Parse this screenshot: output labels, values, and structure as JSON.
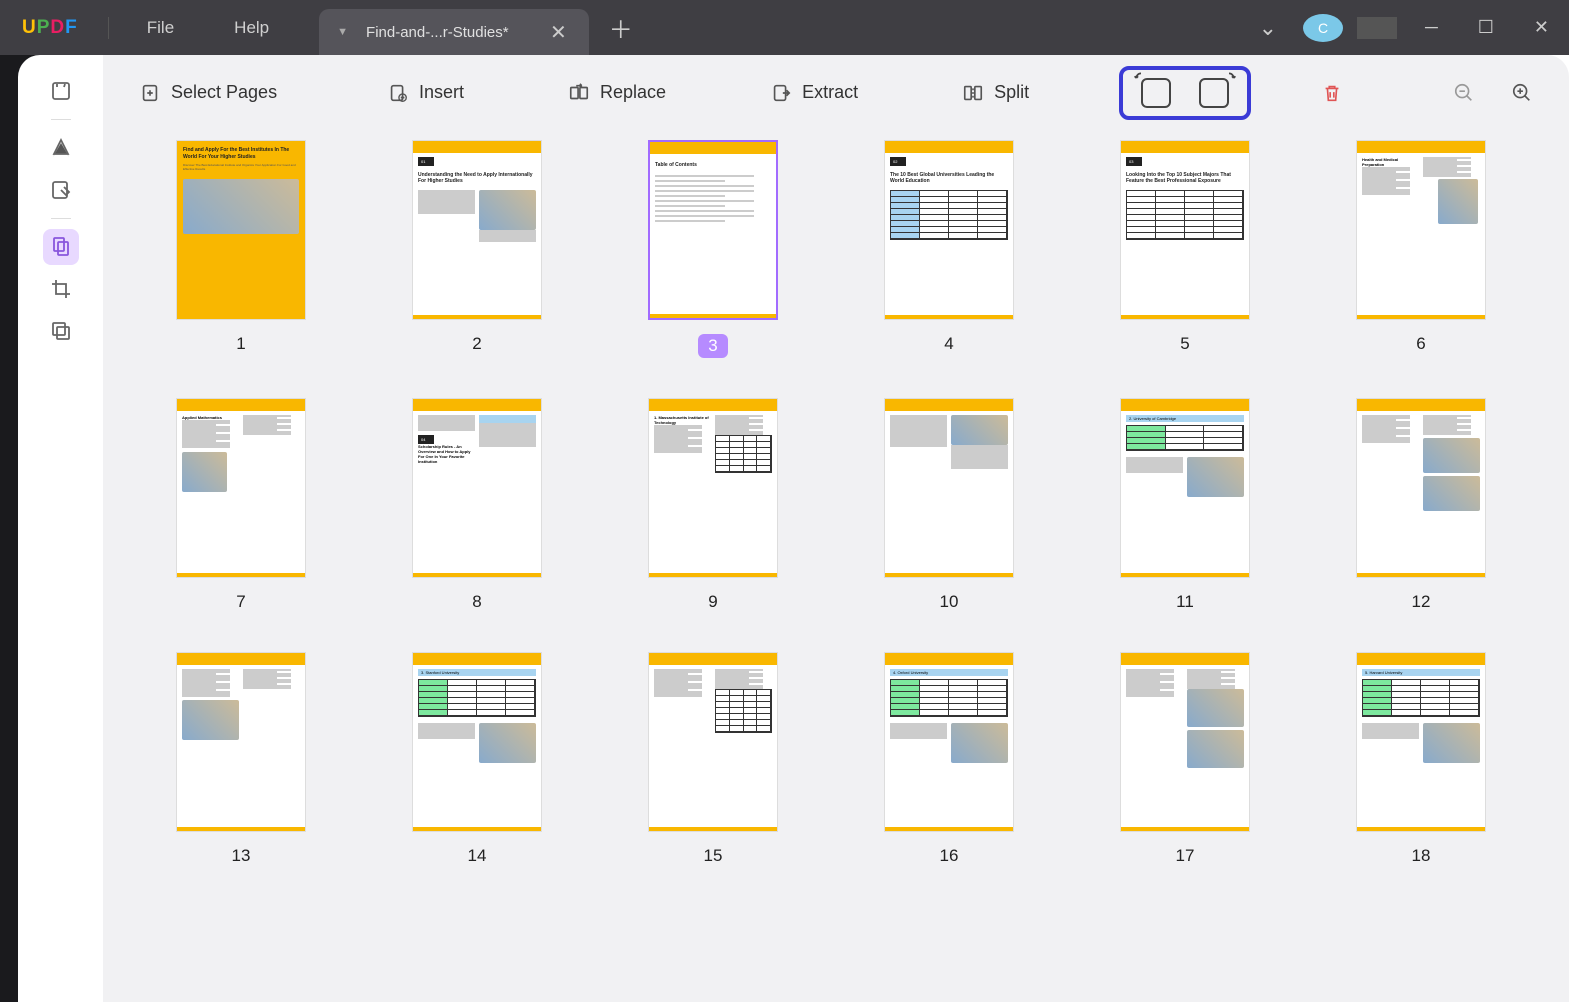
{
  "app": {
    "logo_u": "U",
    "logo_p": "P",
    "logo_d": "D",
    "logo_f": "F"
  },
  "menu": {
    "file": "File",
    "help": "Help"
  },
  "tab": {
    "title": "Find-and-...r-Studies*"
  },
  "avatar": "C",
  "toolbar": {
    "select": "Select Pages",
    "insert": "Insert",
    "replace": "Replace",
    "extract": "Extract",
    "split": "Split"
  },
  "pages": [
    {
      "n": "1",
      "sel": false
    },
    {
      "n": "2",
      "sel": false
    },
    {
      "n": "3",
      "sel": true
    },
    {
      "n": "4",
      "sel": false
    },
    {
      "n": "5",
      "sel": false
    },
    {
      "n": "6",
      "sel": false
    },
    {
      "n": "7",
      "sel": false
    },
    {
      "n": "8",
      "sel": false
    },
    {
      "n": "9",
      "sel": false
    },
    {
      "n": "10",
      "sel": false
    },
    {
      "n": "11",
      "sel": false
    },
    {
      "n": "12",
      "sel": false
    },
    {
      "n": "13",
      "sel": false
    },
    {
      "n": "14",
      "sel": false
    },
    {
      "n": "15",
      "sel": false
    },
    {
      "n": "16",
      "sel": false
    },
    {
      "n": "17",
      "sel": false
    },
    {
      "n": "18",
      "sel": false
    }
  ],
  "page_content": {
    "1": {
      "type": "cover",
      "title": "Find and Apply For the Best Institutes In The World For Your Higher Studies",
      "sub": "Discover The Best Educational Institute and Organize Your Application For Good and Effective Results"
    },
    "2": {
      "type": "chapter",
      "num": "01",
      "title": "Understanding the Need to Apply Internationally For Higher Studies"
    },
    "3": {
      "type": "toc",
      "title": "Table of Contents"
    },
    "4": {
      "type": "chapter",
      "num": "02",
      "title": "The 10 Best Global Universities Leading the World Education"
    },
    "5": {
      "type": "chapter",
      "num": "03",
      "title": "Looking Into the Top 10 Subject Majors That Feature the Best Professional Exposure"
    },
    "6": {
      "type": "text",
      "heading": "Health and Medical Preparation"
    },
    "7": {
      "type": "text",
      "heading": "Applied Mathematics"
    },
    "8": {
      "type": "chapter",
      "num": "04",
      "title": "Scholarship Rules - An Overview and How to Apply For One In Your Favorite Institution"
    },
    "9": {
      "type": "text",
      "heading": "1. Massachusetts Institute of Technology"
    },
    "10": {
      "type": "text",
      "heading": ""
    },
    "11": {
      "type": "uni",
      "heading": "2. University of Cambridge"
    },
    "12": {
      "type": "text",
      "heading": ""
    },
    "13": {
      "type": "text",
      "heading": ""
    },
    "14": {
      "type": "uni",
      "heading": "3. Stanford University"
    },
    "15": {
      "type": "text",
      "heading": ""
    },
    "16": {
      "type": "uni",
      "heading": "4. Oxford University"
    },
    "17": {
      "type": "text",
      "heading": ""
    },
    "18": {
      "type": "uni",
      "heading": "5. Harvard University"
    }
  }
}
